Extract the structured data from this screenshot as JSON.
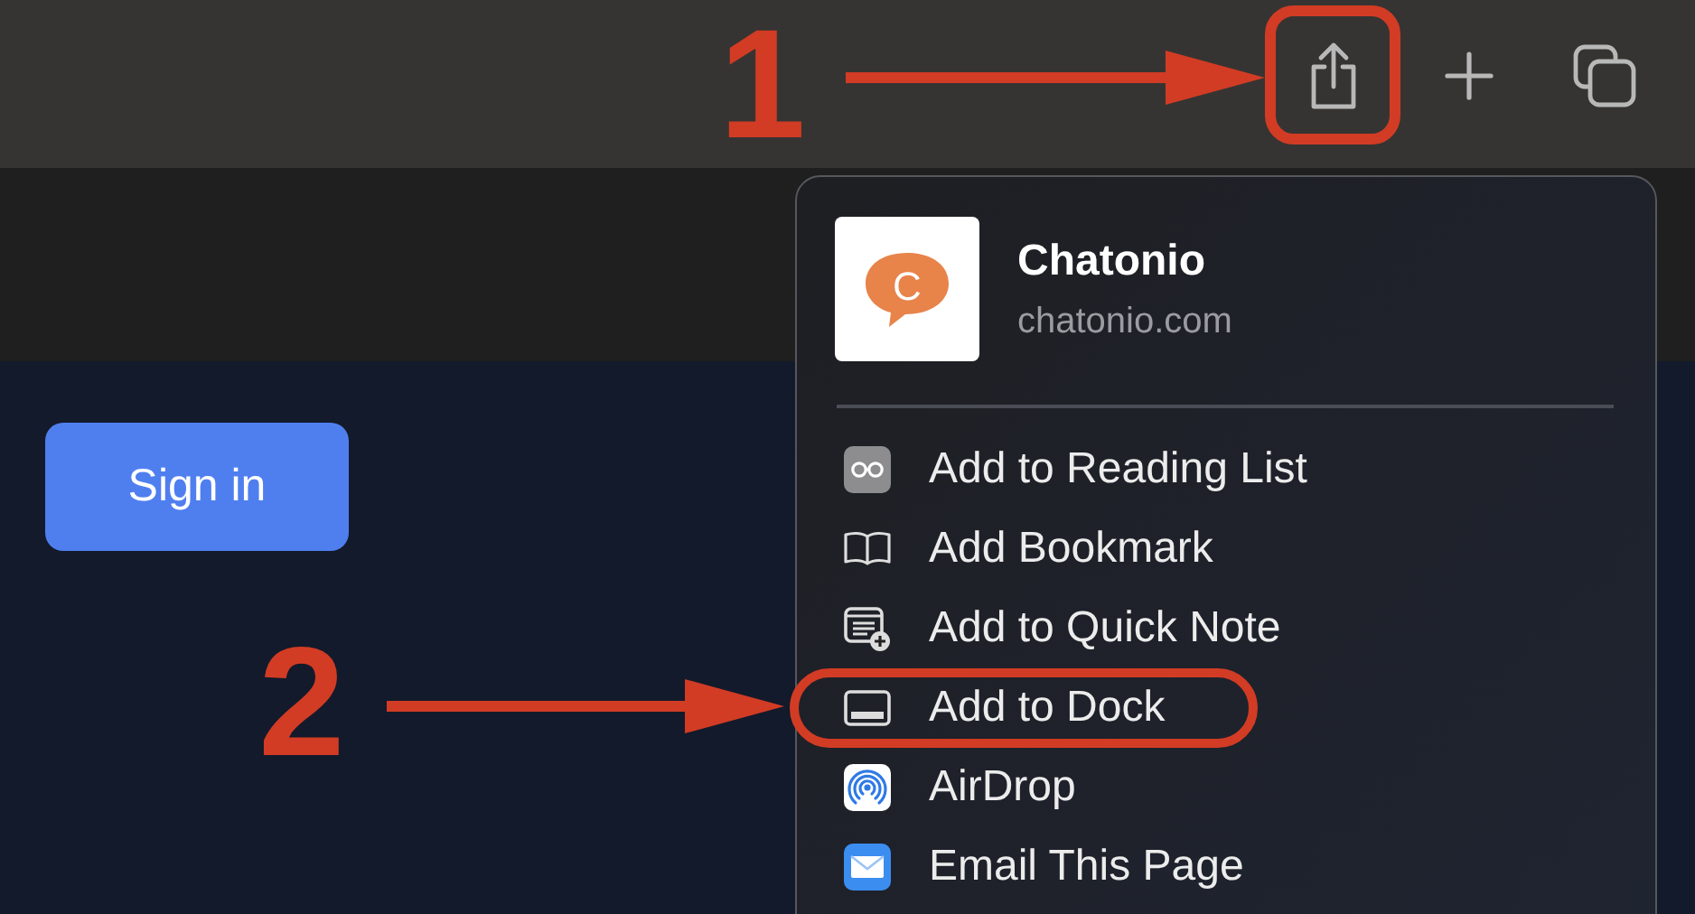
{
  "toolbar": {
    "buttons": [
      {
        "kind": "share",
        "highlighted": true
      },
      {
        "kind": "new-tab",
        "highlighted": false
      },
      {
        "kind": "tabs",
        "highlighted": false
      }
    ]
  },
  "page": {
    "sign_in": "Sign in"
  },
  "share_menu": {
    "site_name": "Chatonio",
    "site_domain": "chatonio.com",
    "logo_letter": "C",
    "items": [
      {
        "kind": "reading-list",
        "label": "Add to Reading List",
        "highlighted": false
      },
      {
        "kind": "bookmark",
        "label": "Add Bookmark",
        "highlighted": false
      },
      {
        "kind": "quick-note",
        "label": "Add to Quick Note",
        "highlighted": false
      },
      {
        "kind": "dock",
        "label": "Add to Dock",
        "highlighted": true
      },
      {
        "kind": "airdrop",
        "label": "AirDrop",
        "highlighted": false
      },
      {
        "kind": "email",
        "label": "Email This Page",
        "highlighted": false
      }
    ]
  },
  "callouts": [
    {
      "label": "1"
    },
    {
      "label": "2"
    }
  ]
}
